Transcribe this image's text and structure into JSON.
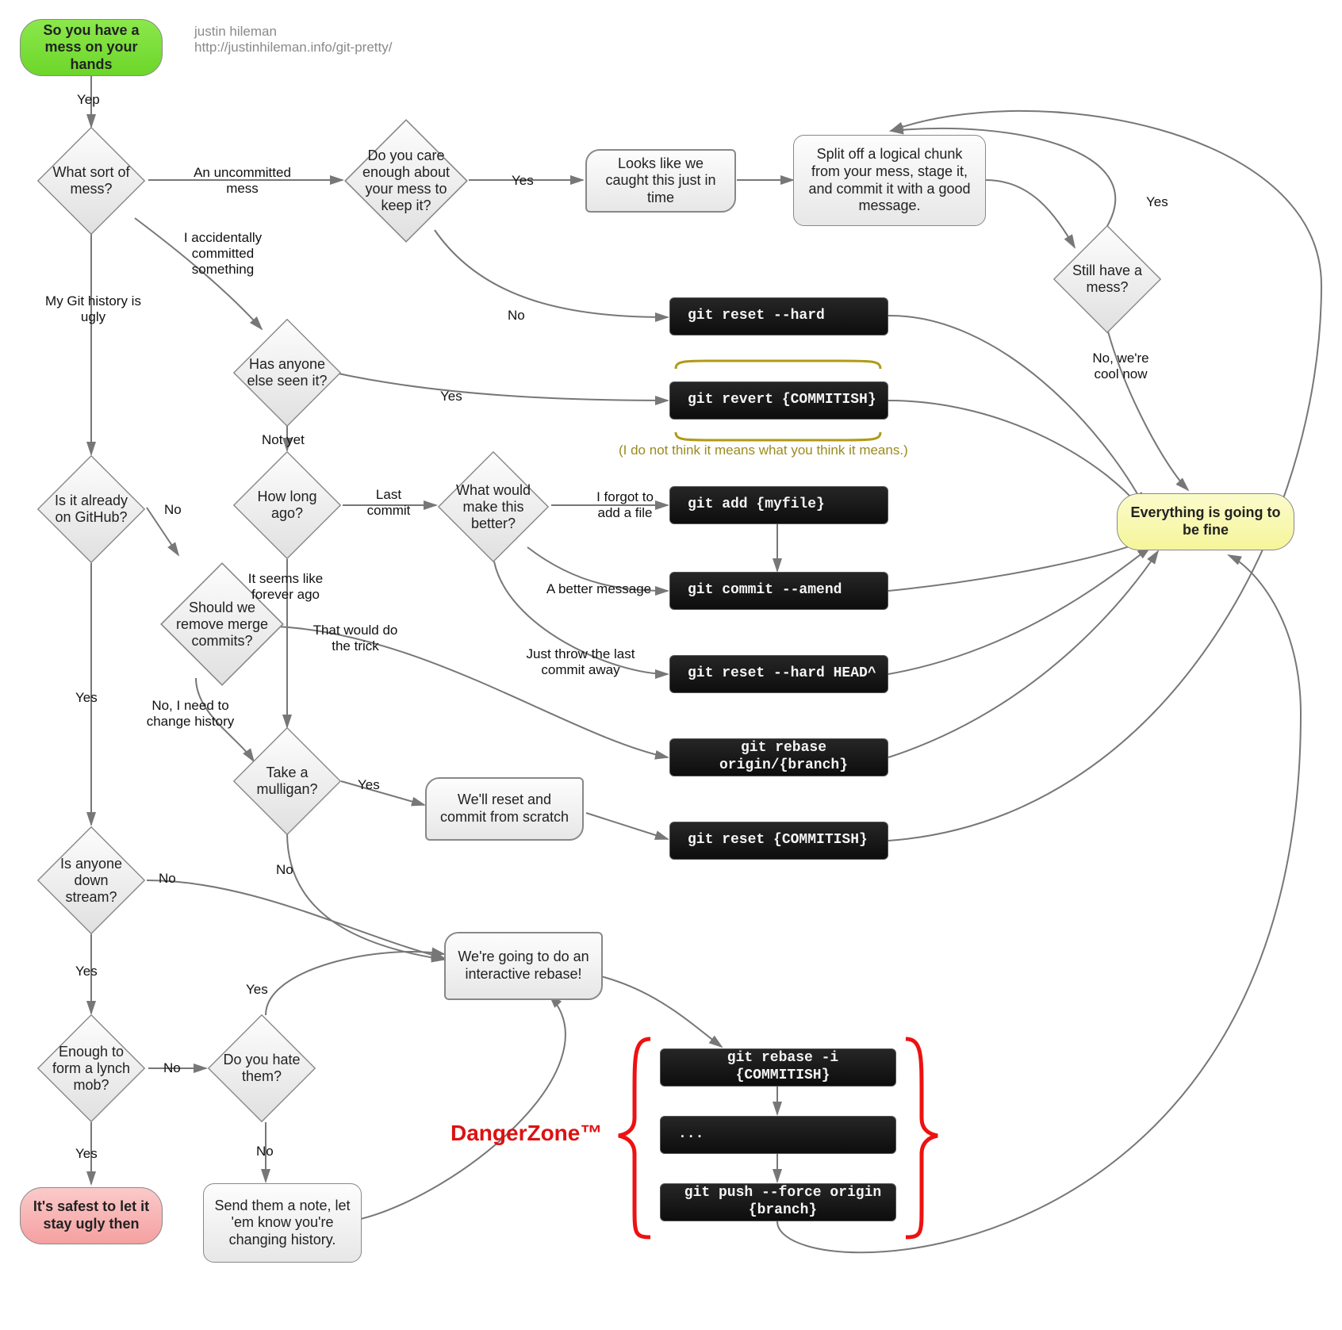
{
  "meta": {
    "author": "justin hileman",
    "url": "http://justinhileman.info/git-pretty/"
  },
  "terminals": {
    "start": "So you have a mess on your hands",
    "fine": "Everything is going to be fine",
    "safest": "It's safest to let it stay ugly then"
  },
  "decisions": {
    "sort": "What sort of mess?",
    "care": "Do you care enough about your mess to keep it?",
    "seen": "Has anyone else seen it?",
    "howlong": "How long ago?",
    "better": "What would make this better?",
    "github": "Is it already on GitHub?",
    "removemerge": "Should we remove merge commits?",
    "mulligan": "Take a mulligan?",
    "downstream": "Is anyone down stream?",
    "lynchmob": "Enough to form a lynch mob?",
    "hatethem": "Do you hate them?",
    "stillmess": "Still have a mess?"
  },
  "statements": {
    "caught": "Looks like we caught this just in time",
    "resetcommit": "We'll reset and commit from scratch",
    "interactive": "We're going to do an interactive rebase!"
  },
  "processes": {
    "splitoff": "Split off a logical chunk from your mess, stage it, and commit it with a good message.",
    "sendnote": "Send them a note, let 'em know you're changing history."
  },
  "commands": {
    "resethard": "git reset --hard",
    "revert": "git revert {COMMITISH}",
    "add": "git add {myfile}",
    "amend": "git commit --amend",
    "resetheadcaret": "git reset --hard HEAD^",
    "rebaseorigin": "git rebase origin/{branch}",
    "resetcommitish": "git reset {COMMITISH}",
    "rebaseinteractive": "git rebase -i {COMMITISH}",
    "ellipsis": "...",
    "forcepush": "git push --force origin {branch}"
  },
  "edge_labels": {
    "yep": "Yep",
    "uncommitted": "An uncommitted mess",
    "accidentally": "I accidentally committed something",
    "historyugly": "My Git history is ugly",
    "yes": "Yes",
    "no": "No",
    "careno": "No",
    "notyet": "Not yet",
    "lastcommit": "Last commit",
    "forever": "It seems like forever ago",
    "forgotfile": "I forgot to add a file",
    "bettermsg": "A better message",
    "throwaway": "Just throw the last commit away",
    "githubyes": "Yes",
    "githubno": "No",
    "mergetrick": "That would do the trick",
    "changehistory": "No, I need to change history",
    "mulliganyes": "Yes",
    "mulliganno": "No",
    "downyes": "Yes",
    "downno": "No",
    "mobyes": "Yes",
    "mobno": "No",
    "hateyes": "Yes",
    "hateno": "No",
    "stillyes": "Yes",
    "stillno": "No, we're cool now"
  },
  "annotations": {
    "notetext": "(I do not think it means what you think it means.)",
    "dangerzone": "DangerZone™"
  },
  "chart_data": {
    "type": "flowchart",
    "nodes": [
      {
        "id": "start",
        "kind": "terminal",
        "label": "So you have a mess on your hands"
      },
      {
        "id": "sort",
        "kind": "decision",
        "label": "What sort of mess?"
      },
      {
        "id": "care",
        "kind": "decision",
        "label": "Do you care enough about your mess to keep it?"
      },
      {
        "id": "caught",
        "kind": "statement",
        "label": "Looks like we caught this just in time"
      },
      {
        "id": "splitoff",
        "kind": "process",
        "label": "Split off a logical chunk from your mess, stage it, and commit it with a good message."
      },
      {
        "id": "stillmess",
        "kind": "decision",
        "label": "Still have a mess?"
      },
      {
        "id": "resethard",
        "kind": "command",
        "label": "git reset --hard"
      },
      {
        "id": "seen",
        "kind": "decision",
        "label": "Has anyone else seen it?"
      },
      {
        "id": "revert",
        "kind": "command",
        "label": "git revert {COMMITISH}"
      },
      {
        "id": "howlong",
        "kind": "decision",
        "label": "How long ago?"
      },
      {
        "id": "better",
        "kind": "decision",
        "label": "What would make this better?"
      },
      {
        "id": "add",
        "kind": "command",
        "label": "git add {myfile}"
      },
      {
        "id": "amend",
        "kind": "command",
        "label": "git commit --amend"
      },
      {
        "id": "resetheadcaret",
        "kind": "command",
        "label": "git reset --hard HEAD^"
      },
      {
        "id": "github",
        "kind": "decision",
        "label": "Is it already on GitHub?"
      },
      {
        "id": "removemerge",
        "kind": "decision",
        "label": "Should we remove merge commits?"
      },
      {
        "id": "rebaseorigin",
        "kind": "command",
        "label": "git rebase origin/{branch}"
      },
      {
        "id": "mulligan",
        "kind": "decision",
        "label": "Take a mulligan?"
      },
      {
        "id": "resetcommit",
        "kind": "statement",
        "label": "We'll reset and commit from scratch"
      },
      {
        "id": "resetcommitish",
        "kind": "command",
        "label": "git reset {COMMITISH}"
      },
      {
        "id": "downstream",
        "kind": "decision",
        "label": "Is anyone down stream?"
      },
      {
        "id": "interactive",
        "kind": "statement",
        "label": "We're going to do an interactive rebase!"
      },
      {
        "id": "rebaseinteractive",
        "kind": "command",
        "label": "git rebase -i {COMMITISH}"
      },
      {
        "id": "ellipsis",
        "kind": "command",
        "label": "..."
      },
      {
        "id": "forcepush",
        "kind": "command",
        "label": "git push --force origin {branch}"
      },
      {
        "id": "lynchmob",
        "kind": "decision",
        "label": "Enough to form a lynch mob?"
      },
      {
        "id": "hatethem",
        "kind": "decision",
        "label": "Do you hate them?"
      },
      {
        "id": "sendnote",
        "kind": "process",
        "label": "Send them a note, let 'em know you're changing history."
      },
      {
        "id": "safest",
        "kind": "terminal",
        "label": "It's safest to let it stay ugly then"
      },
      {
        "id": "fine",
        "kind": "terminal",
        "label": "Everything is going to be fine"
      }
    ],
    "edges": [
      {
        "from": "start",
        "to": "sort",
        "label": "Yep"
      },
      {
        "from": "sort",
        "to": "care",
        "label": "An uncommitted mess"
      },
      {
        "from": "sort",
        "to": "seen",
        "label": "I accidentally committed something"
      },
      {
        "from": "sort",
        "to": "github",
        "label": "My Git history is ugly"
      },
      {
        "from": "care",
        "to": "caught",
        "label": "Yes"
      },
      {
        "from": "care",
        "to": "resethard",
        "label": "No"
      },
      {
        "from": "caught",
        "to": "splitoff",
        "label": ""
      },
      {
        "from": "splitoff",
        "to": "stillmess",
        "label": ""
      },
      {
        "from": "stillmess",
        "to": "splitoff",
        "label": "Yes"
      },
      {
        "from": "stillmess",
        "to": "fine",
        "label": "No, we're cool now"
      },
      {
        "from": "resethard",
        "to": "fine",
        "label": ""
      },
      {
        "from": "seen",
        "to": "revert",
        "label": "Yes"
      },
      {
        "from": "seen",
        "to": "howlong",
        "label": "Not yet"
      },
      {
        "from": "revert",
        "to": "fine",
        "label": ""
      },
      {
        "from": "howlong",
        "to": "better",
        "label": "Last commit"
      },
      {
        "from": "howlong",
        "to": "mulligan",
        "label": "It seems like forever ago"
      },
      {
        "from": "better",
        "to": "add",
        "label": "I forgot to add a file"
      },
      {
        "from": "better",
        "to": "amend",
        "label": "A better message"
      },
      {
        "from": "better",
        "to": "resetheadcaret",
        "label": "Just throw the last commit away"
      },
      {
        "from": "add",
        "to": "amend",
        "label": ""
      },
      {
        "from": "amend",
        "to": "fine",
        "label": ""
      },
      {
        "from": "resetheadcaret",
        "to": "fine",
        "label": ""
      },
      {
        "from": "github",
        "to": "removemerge",
        "label": "No"
      },
      {
        "from": "github",
        "to": "downstream",
        "label": "Yes"
      },
      {
        "from": "removemerge",
        "to": "rebaseorigin",
        "label": "That would do the trick"
      },
      {
        "from": "removemerge",
        "to": "mulligan",
        "label": "No, I need to change history"
      },
      {
        "from": "rebaseorigin",
        "to": "fine",
        "label": ""
      },
      {
        "from": "mulligan",
        "to": "resetcommit",
        "label": "Yes"
      },
      {
        "from": "mulligan",
        "to": "interactive",
        "label": "No"
      },
      {
        "from": "resetcommit",
        "to": "resetcommitish",
        "label": ""
      },
      {
        "from": "resetcommitish",
        "to": "splitoff",
        "label": ""
      },
      {
        "from": "downstream",
        "to": "interactive",
        "label": "No"
      },
      {
        "from": "downstream",
        "to": "lynchmob",
        "label": "Yes"
      },
      {
        "from": "lynchmob",
        "to": "safest",
        "label": "Yes"
      },
      {
        "from": "lynchmob",
        "to": "hatethem",
        "label": "No"
      },
      {
        "from": "hatethem",
        "to": "interactive",
        "label": "Yes"
      },
      {
        "from": "hatethem",
        "to": "sendnote",
        "label": "No"
      },
      {
        "from": "sendnote",
        "to": "interactive",
        "label": ""
      },
      {
        "from": "interactive",
        "to": "rebaseinteractive",
        "label": ""
      },
      {
        "from": "rebaseinteractive",
        "to": "ellipsis",
        "label": ""
      },
      {
        "from": "ellipsis",
        "to": "forcepush",
        "label": ""
      },
      {
        "from": "forcepush",
        "to": "fine",
        "label": ""
      }
    ],
    "groups": [
      {
        "id": "dangerzone",
        "label": "DangerZone™",
        "nodes": [
          "rebaseinteractive",
          "ellipsis",
          "forcepush"
        ],
        "style": "red-bracket"
      },
      {
        "id": "revertnote",
        "label": "(I do not think it means what you think it means.)",
        "nodes": [
          "revert"
        ],
        "style": "curly-braces"
      }
    ]
  }
}
